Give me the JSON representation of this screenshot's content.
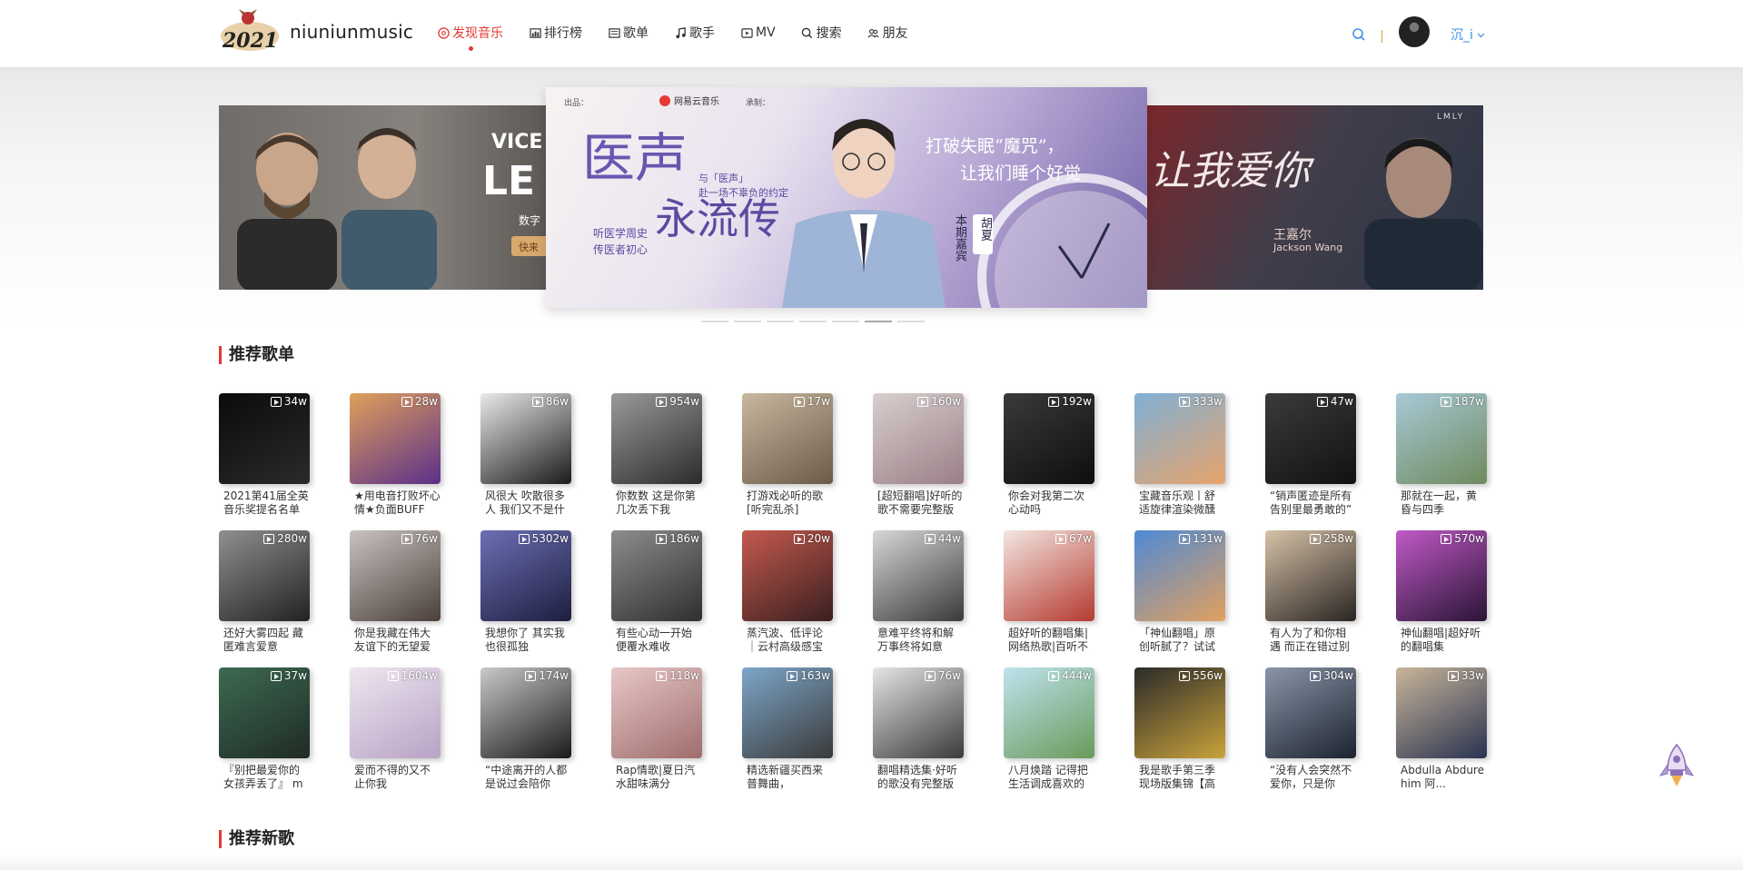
{
  "header": {
    "logo_text": "niuniunmusic",
    "logo_year": "2021",
    "nav": [
      {
        "label": "发现音乐",
        "icon": "disc-icon",
        "active": true
      },
      {
        "label": "排行榜",
        "icon": "chart-icon",
        "active": false
      },
      {
        "label": "歌单",
        "icon": "list-icon",
        "active": false
      },
      {
        "label": "歌手",
        "icon": "note-icon",
        "active": false
      },
      {
        "label": "MV",
        "icon": "video-icon",
        "active": false
      },
      {
        "label": "搜索",
        "icon": "search-icon",
        "active": false
      },
      {
        "label": "朋友",
        "icon": "friends-icon",
        "active": false
      }
    ],
    "username": "沉_i"
  },
  "banner": {
    "center": {
      "title_a": "医声",
      "title_b": "永流传",
      "subtitle_a": "与「医声」",
      "subtitle_b": "赴一场不辜负的约定",
      "tagline_a": "打破失眠“魔咒”，",
      "tagline_b": "让我们睡个好觉",
      "side_a": "听医学周史",
      "side_b": "传医者初心",
      "guest_label": "本期嘉宾",
      "guest_name": "胡夏",
      "sponsor": "网易云音乐",
      "producer_label": "出品：",
      "coproducer_label": "承制："
    },
    "left": {
      "text_a": "VICE",
      "text_b": "LE",
      "text_c": "数字",
      "text_d": "快来"
    },
    "right": {
      "text_a": "让我爱你",
      "text_b": "王嘉尔",
      "text_c": "Jackson Wang",
      "text_d": "LMLY"
    },
    "slide_count": 7,
    "active_slide": 5
  },
  "sections": {
    "playlists_title": "推荐歌单",
    "new_songs_title": "推荐新歌"
  },
  "playlists": [
    {
      "count": "34w",
      "title": "2021第41届全英音乐奖提名名单",
      "color1": "#0b0b0b",
      "color2": "#2a2a2a"
    },
    {
      "count": "28w",
      "title": "★用电音打败坏心情★负面BUFF快...",
      "color1": "#e0a05a",
      "color2": "#5b2f8a"
    },
    {
      "count": "86w",
      "title": "风很大 吹散很多人 我们又不是什么...",
      "color1": "#e9e9e9",
      "color2": "#1b1b1b"
    },
    {
      "count": "954w",
      "title": "你数数 这是你第几次丢下我",
      "color1": "#9a9a9a",
      "color2": "#2c2c2c"
    },
    {
      "count": "17w",
      "title": "打游戏必听的歌 [听完乱杀]",
      "color1": "#c8b8a0",
      "color2": "#6b5a48"
    },
    {
      "count": "160w",
      "title": "[超短翻唱]好听的歌不需要完整版",
      "color1": "#d8cfcf",
      "color2": "#9a7f86"
    },
    {
      "count": "192w",
      "title": "你会对我第二次心动吗",
      "color1": "#3a3a3a",
      "color2": "#0e0e0e"
    },
    {
      "count": "333w",
      "title": "宝藏音乐观丨舒适旋律渲染微醺夜色",
      "color1": "#7fb0d6",
      "color2": "#e7a36b"
    },
    {
      "count": "47w",
      "title": "“销声匿迹是所有告别里最勇敢的”",
      "color1": "#3b3b3b",
      "color2": "#111"
    },
    {
      "count": "187w",
      "title": "那就在一起，黄昏与四季",
      "color1": "#a8c9d8",
      "color2": "#6f8a5d"
    },
    {
      "count": "280w",
      "title": "还好大雾四起 藏匿难言爱意",
      "color1": "#8f8f8f",
      "color2": "#222"
    },
    {
      "count": "76w",
      "title": "你是我藏在伟大友谊下的无望爱人",
      "color1": "#c9c2c0",
      "color2": "#4a3f3a"
    },
    {
      "count": "5302w",
      "title": "我想你了 其实我也很孤独",
      "color1": "#6c6fb4",
      "color2": "#1d1e3f"
    },
    {
      "count": "186w",
      "title": "有些心动一开始便覆水难收",
      "color1": "#8d8d8d",
      "color2": "#2f2f2f"
    },
    {
      "count": "20w",
      "title": "蒸汽波、低评论｜云村高级感宝藏...",
      "color1": "#c45a4e",
      "color2": "#3a1f20"
    },
    {
      "count": "44w",
      "title": "意难平终将和解 万事终将如意",
      "color1": "#d7d7d7",
      "color2": "#3a3a3a"
    },
    {
      "count": "67w",
      "title": "超好听的翻唱集|网络热歌|百听不厌",
      "color1": "#f3e6e1",
      "color2": "#b53a30"
    },
    {
      "count": "131w",
      "title": "「神仙翻唱」原创听腻了？试试这...",
      "color1": "#4e8ad6",
      "color2": "#e2a05e"
    },
    {
      "count": "258w",
      "title": "有人为了和你相遇 而正在错过别人",
      "color1": "#d6c2a8",
      "color2": "#2a2522"
    },
    {
      "count": "570w",
      "title": "神仙翻唱|超好听的翻唱集",
      "color1": "#c05ac6",
      "color2": "#2a1436"
    },
    {
      "count": "37w",
      "title": "『别把最爱你的女孩弄丢了』 mun...",
      "color1": "#3d6a52",
      "color2": "#1f2b24"
    },
    {
      "count": "1604w",
      "title": "爱而不得的又不止你我",
      "color1": "#efe6f0",
      "color2": "#b7a2c4"
    },
    {
      "count": "174w",
      "title": "“中途离开的人都是说过会陪你好...",
      "color1": "#c9c9c9",
      "color2": "#1a1a1a"
    },
    {
      "count": "118w",
      "title": "Rap情歌|夏日汽水甜味满分",
      "color1": "#e8c7c7",
      "color2": "#9f6d6d"
    },
    {
      "count": "163w",
      "title": "精选新疆买西来普舞曲，",
      "color1": "#7da6c9",
      "color2": "#3a3a3a"
    },
    {
      "count": "76w",
      "title": "翻唱精选集·好听的歌没有完整版系列",
      "color1": "#e5e5e5",
      "color2": "#3a3a3a"
    },
    {
      "count": "444w",
      "title": "八月焕踏 记得把生活调成喜欢的频道",
      "color1": "#bfe3ee",
      "color2": "#6a9a5a"
    },
    {
      "count": "556w",
      "title": "我是歌手第三季现场版集锦【高品...",
      "color1": "#2a2a2a",
      "color2": "#c9a23a"
    },
    {
      "count": "304w",
      "title": "“没有人会突然不爱你，只是你突...",
      "color1": "#8a96a8",
      "color2": "#1c2230"
    },
    {
      "count": "33w",
      "title": "Abdulla Abdurehim 阿...",
      "color1": "#c8b59a",
      "color2": "#2a3350"
    }
  ]
}
